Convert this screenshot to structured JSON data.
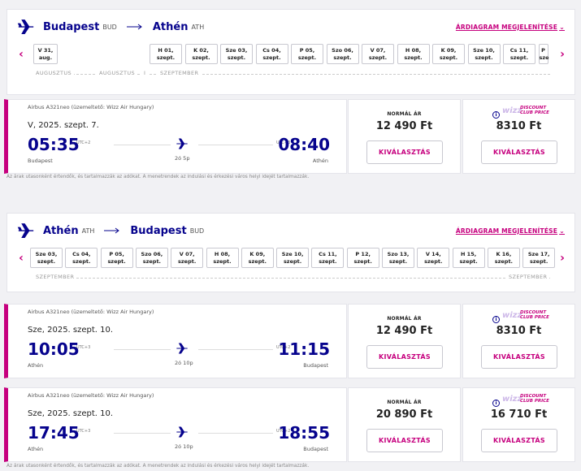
{
  "section1": {
    "from_city": "Budapest",
    "from_code": "BUD",
    "to_city": "Athén",
    "to_code": "ATH",
    "chart_link": "ÁRDIAGRAM MEGJELENÍTÉSE",
    "dates": [
      [
        "V 31,",
        "aug."
      ],
      [
        "H 01,",
        "szept."
      ],
      [
        "K 02,",
        "szept."
      ],
      [
        "Sze 03,",
        "szept."
      ],
      [
        "Cs 04,",
        "szept."
      ],
      [
        "P 05,",
        "szept."
      ],
      [
        "Szo 06,",
        "szept."
      ],
      [
        "V 07,",
        "szept."
      ],
      [
        "H 08,",
        "szept."
      ],
      [
        "K 09,",
        "szept."
      ],
      [
        "Sze 10,",
        "szept."
      ],
      [
        "Cs 11,",
        "szept."
      ],
      [
        "P",
        "sze"
      ]
    ],
    "months": [
      "AUGUSZTUS",
      "AUGUSZTUS",
      "I",
      "SZEPTEMBER"
    ],
    "flights": [
      {
        "aircraft": "Airbus A321neo (üzemeltető: Wizz Air Hungary)",
        "date": "V, 2025. szept. 7.",
        "dep": "05:35",
        "dep_utc": "UTC+2",
        "dep_city": "Budapest",
        "arr": "08:40",
        "arr_utc": "UTC+3",
        "arr_city": "Athén",
        "duration": "2ó 5p",
        "normal_label": "NORMÁL ÁR",
        "normal_price": "12 490 Ft",
        "dc_price": "8310 Ft",
        "select": "KIVÁLASZTÁS"
      }
    ],
    "note": "Az árak utasonként értendők, és tartalmazzák az adókat. A menetrendek az indulási és érkezési város helyi idejét tartalmazzák."
  },
  "section2": {
    "from_city": "Athén",
    "from_code": "ATH",
    "to_city": "Budapest",
    "to_code": "BUD",
    "chart_link": "ÁRDIAGRAM MEGJELENÍTÉSE",
    "dates": [
      [
        "Sze 03,",
        "szept."
      ],
      [
        "Cs 04,",
        "szept."
      ],
      [
        "P 05,",
        "szept."
      ],
      [
        "Szo 06,",
        "szept."
      ],
      [
        "V 07,",
        "szept."
      ],
      [
        "H 08,",
        "szept."
      ],
      [
        "K 09,",
        "szept."
      ],
      [
        "Sze 10,",
        "szept."
      ],
      [
        "Cs 11,",
        "szept."
      ],
      [
        "P 12,",
        "szept."
      ],
      [
        "Szo 13,",
        "szept."
      ],
      [
        "V 14,",
        "szept."
      ],
      [
        "H 15,",
        "szept."
      ],
      [
        "K 16,",
        "szept."
      ],
      [
        "Sze 17,",
        "szept."
      ]
    ],
    "months": [
      "SZEPTEMBER",
      "SZEPTEMBER"
    ],
    "flights": [
      {
        "aircraft": "Airbus A321neo (üzemeltető: Wizz Air Hungary)",
        "date": "Sze, 2025. szept. 10.",
        "dep": "10:05",
        "dep_utc": "UTC+3",
        "dep_city": "Athén",
        "arr": "11:15",
        "arr_utc": "UTC+2",
        "arr_city": "Budapest",
        "duration": "2ó 10p",
        "normal_label": "NORMÁL ÁR",
        "normal_price": "12 490 Ft",
        "dc_price": "8310 Ft",
        "select": "KIVÁLASZTÁS"
      },
      {
        "aircraft": "Airbus A321neo (üzemeltető: Wizz Air Hungary)",
        "date": "Sze, 2025. szept. 10.",
        "dep": "17:45",
        "dep_utc": "UTC+3",
        "dep_city": "Athén",
        "arr": "18:55",
        "arr_utc": "UTC+2",
        "arr_city": "Budapest",
        "duration": "2ó 10p",
        "normal_label": "NORMÁL ÁR",
        "normal_price": "20 890 Ft",
        "dc_price": "16 710 Ft",
        "select": "KIVÁLASZTÁS"
      }
    ],
    "note": "Az árak utasonként értendők, és tartalmazzák az adókat. A menetrendek az indulási és érkezési város helyi idejét tartalmazzák."
  },
  "discount_club": {
    "brand": "wizz",
    "line1": "DISCOUNT",
    "line2": "CLUB PRICE"
  },
  "icons": {
    "plane": "airplane-icon",
    "arrow": "arrow-right-icon",
    "info": "info-icon"
  },
  "colors": {
    "brand_blue": "#06038d",
    "brand_pink": "#c6007e"
  }
}
